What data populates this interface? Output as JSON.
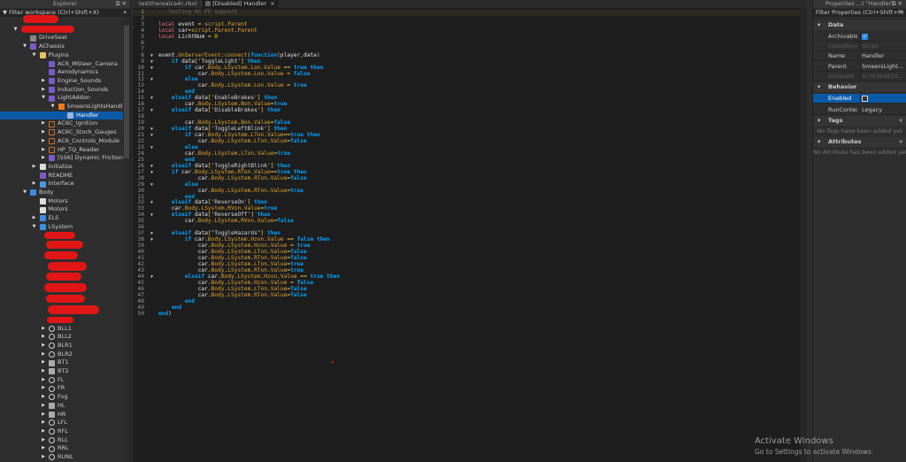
{
  "explorer": {
    "title": "Explorer",
    "filter_placeholder": "Filter workspace (Ctrl+Shift+X)",
    "items": [
      {
        "label": "",
        "depth": 0,
        "arrow": "",
        "icon": "redacted",
        "redacted": true
      },
      {
        "label": "",
        "depth": 1,
        "arrow": "open",
        "icon": "model-icon",
        "redacted": true
      },
      {
        "label": "DriveSeat",
        "depth": 2,
        "arrow": "",
        "icon": "seat-icon"
      },
      {
        "label": "AChassis",
        "depth": 2,
        "arrow": "open",
        "icon": "localscript-icon"
      },
      {
        "label": "Plugins",
        "depth": 3,
        "arrow": "open",
        "icon": "folder-icon"
      },
      {
        "label": "AC6_MSteer_Camera",
        "depth": 4,
        "arrow": "",
        "icon": "localscript-icon"
      },
      {
        "label": "Aerodynamics",
        "depth": 4,
        "arrow": "",
        "icon": "localscript-icon"
      },
      {
        "label": "Engine_Sounds",
        "depth": 4,
        "arrow": "closed",
        "icon": "localscript-icon"
      },
      {
        "label": "Induction_Sounds",
        "depth": 4,
        "arrow": "closed",
        "icon": "localscript-icon"
      },
      {
        "label": "LightAddon",
        "depth": 4,
        "arrow": "open",
        "icon": "localscript-icon"
      },
      {
        "label": "SmeersLightsHandler",
        "depth": 5,
        "arrow": "open",
        "icon": "remoteevent-icon"
      },
      {
        "label": "Handler",
        "depth": 6,
        "arrow": "",
        "icon": "script-icon",
        "selected": true
      },
      {
        "label": "AC6C_Ignition",
        "depth": 4,
        "arrow": "closed",
        "icon": "frame-icon"
      },
      {
        "label": "AC6C_Stock_Gauges",
        "depth": 4,
        "arrow": "closed",
        "icon": "frame-icon"
      },
      {
        "label": "AC6_Controls_Module",
        "depth": 4,
        "arrow": "closed",
        "icon": "frame-icon"
      },
      {
        "label": "HP_TQ_Reader",
        "depth": 4,
        "arrow": "closed",
        "icon": "frame-icon"
      },
      {
        "label": "[SS6] Dynamic Friction",
        "depth": 4,
        "arrow": "closed",
        "icon": "localscript-icon"
      },
      {
        "label": "Initialize",
        "depth": 3,
        "arrow": "closed",
        "icon": "modulescript-icon"
      },
      {
        "label": "README",
        "depth": 3,
        "arrow": "",
        "icon": "localscript-icon"
      },
      {
        "label": "Interface",
        "depth": 3,
        "arrow": "closed",
        "icon": "screengui-icon"
      },
      {
        "label": "Body",
        "depth": 2,
        "arrow": "open",
        "icon": "model-icon"
      },
      {
        "label": "Motors",
        "depth": 3,
        "arrow": "",
        "icon": "modulescript-icon"
      },
      {
        "label": "Motors",
        "depth": 3,
        "arrow": "",
        "icon": "modulescript-icon"
      },
      {
        "label": "ELS",
        "depth": 3,
        "arrow": "closed",
        "icon": "model-icon"
      },
      {
        "label": "LSystem",
        "depth": 3,
        "arrow": "open",
        "icon": "model-icon"
      },
      {
        "label": "BLL1",
        "depth": 4,
        "arrow": "closed",
        "icon": "part-icon"
      },
      {
        "label": "BLL2",
        "depth": 4,
        "arrow": "closed",
        "icon": "part-icon"
      },
      {
        "label": "BLR1",
        "depth": 4,
        "arrow": "closed",
        "icon": "part-icon"
      },
      {
        "label": "BLR2",
        "depth": 4,
        "arrow": "closed",
        "icon": "part-icon"
      },
      {
        "label": "BT1",
        "depth": 4,
        "arrow": "closed",
        "icon": "union-icon"
      },
      {
        "label": "BT2",
        "depth": 4,
        "arrow": "closed",
        "icon": "union-icon"
      },
      {
        "label": "FL",
        "depth": 4,
        "arrow": "closed",
        "icon": "part-icon"
      },
      {
        "label": "FR",
        "depth": 4,
        "arrow": "closed",
        "icon": "part-icon"
      },
      {
        "label": "Fog",
        "depth": 4,
        "arrow": "closed",
        "icon": "part-icon"
      },
      {
        "label": "HL",
        "depth": 4,
        "arrow": "closed",
        "icon": "union-icon"
      },
      {
        "label": "HR",
        "depth": 4,
        "arrow": "closed",
        "icon": "union-icon"
      },
      {
        "label": "LFL",
        "depth": 4,
        "arrow": "closed",
        "icon": "part-icon"
      },
      {
        "label": "RFL",
        "depth": 4,
        "arrow": "closed",
        "icon": "part-icon"
      },
      {
        "label": "RLL",
        "depth": 4,
        "arrow": "closed",
        "icon": "part-icon"
      },
      {
        "label": "RRL",
        "depth": 4,
        "arrow": "closed",
        "icon": "part-icon"
      },
      {
        "label": "RUNL",
        "depth": 4,
        "arrow": "closed",
        "icon": "part-icon"
      }
    ]
  },
  "editor": {
    "tabs": [
      {
        "label": "testtherealca4c.rbxl",
        "active": false
      },
      {
        "label": "[Disabled] Handler",
        "active": true
      }
    ],
    "close_glyph": "×",
    "fold_lines": [
      8,
      9,
      10,
      12,
      15,
      17,
      20,
      21,
      23,
      26,
      27,
      29,
      32,
      34,
      37,
      38,
      44
    ],
    "lines": [
      "-- Testing AC FE support",
      "",
      "local event = script.Parent",
      "local car=script.Parent.Parent",
      "local LichtNum = 0",
      "",
      "",
      "event.OnServerEvent:connect(function(player,data)",
      "    if data['ToggleLight'] then",
      "        if car.Body.LSystem.Lon.Value == true then",
      "            car.Body.LSystem.Lon.Value = false",
      "        else",
      "            car.Body.LSystem.Lon.Value = true",
      "        end",
      "    elseif data['EnableBrakes'] then",
      "        car.Body.LSystem.Bon.Value=true",
      "    elseif data['DisableBrakes'] then",
      "",
      "        car.Body.LSystem.Bon.Value=false",
      "    elseif data['ToggleLeftBlink'] then",
      "        if car.Body.LSystem.LTon.Value==true then",
      "            car.Body.LSystem.LTon.Value=false",
      "        else",
      "        car.Body.LSystem.LTon.Value=true",
      "        end",
      "    elseif data['ToggleRightBlink'] then",
      "    if car.Body.LSystem.RTon.Value==true then",
      "            car.Body.LSystem.RTon.Value=false",
      "        else",
      "            car.Body.LSystem.RTon.Value=true",
      "        end",
      "    elseif data['ReverseOn'] then",
      "    car.Body.LSystem.RVon.Value=true",
      "    elseif data['ReverseOff'] then",
      "        car.Body.LSystem.RVon.Value=false",
      "",
      "    elseif data[\"ToggleHazards\"] then",
      "        if car.Body.LSystem.Hzon.Value == false then",
      "            car.Body.LSystem.Hzon.Value = true",
      "            car.Body.LSystem.LTon.Value=false",
      "            car.Body.LSystem.RTon.Value=false",
      "            car.Body.LSystem.LTon.Value=true",
      "            car.Body.LSystem.RTon.Value=true",
      "        elseif car.Body.LSystem.Hzon.Value == true then",
      "            car.Body.LSystem.Hzon.Value = false",
      "            car.Body.LSystem.LTon.Value=false",
      "            car.Body.LSystem.RTon.Value=false",
      "        end",
      "    end",
      "end)"
    ]
  },
  "properties": {
    "title": "Properties ...t \"Handler\"",
    "filter_placeholder": "Filter Properties (Ctrl+Shift+P)",
    "sections": {
      "data": "Data",
      "behavior": "Behavior",
      "tags": "Tags",
      "attributes": "Attributes"
    },
    "rows": {
      "archivable": {
        "key": "Archivable",
        "checked": true
      },
      "classname": {
        "key": "ClassName",
        "value": "Script"
      },
      "name": {
        "key": "Name",
        "value": "Handler"
      },
      "parent": {
        "key": "Parent",
        "value": "SmeersLightsH..."
      },
      "uniqueid": {
        "key": "UniqueId",
        "value": "4c05324610475..."
      },
      "enabled": {
        "key": "Enabled",
        "checked": false
      },
      "runcontext": {
        "key": "RunContext",
        "value": "Legacy"
      }
    },
    "tags_note": "No Tags have been added yet",
    "attributes_note": "No Attribute has been added yet"
  },
  "watermark": {
    "title": "Activate Windows",
    "subtitle": "Go to Settings to activate Windows."
  },
  "colors": {
    "selection": "#0b5aa8",
    "keyword": "#00a2ff",
    "local": "#f86d7c",
    "member": "#e0a32c",
    "redaction": "#e01616"
  }
}
